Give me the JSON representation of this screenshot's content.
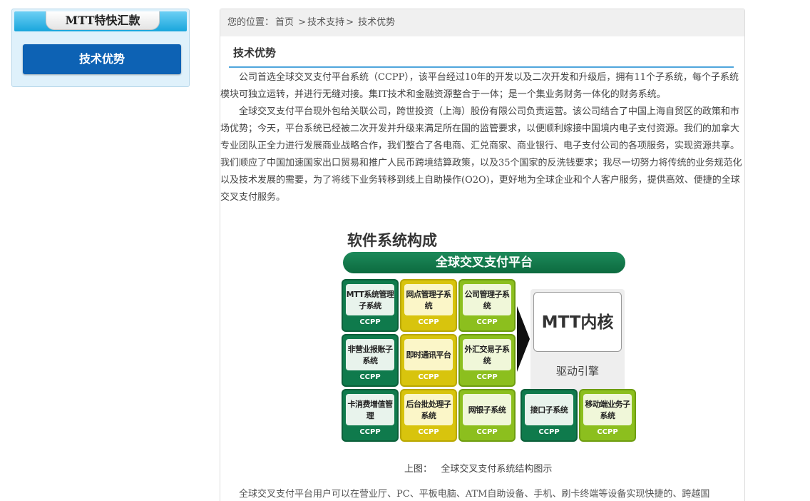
{
  "sidebar": {
    "header": "MTT特快汇款",
    "active_item": "技术优势"
  },
  "breadcrumb": {
    "prefix": "您的位置：",
    "home": "首页",
    "sep1": ">",
    "section": "技术支持",
    "sep2": ">",
    "current": "技术优势"
  },
  "article": {
    "title": "技术优势",
    "paragraphs": [
      "公司首选全球交叉支付平台系统（CCPP），该平台经过10年的开发以及二次开发和升级后，拥有11个子系统，每个子系统模块可独立运转，并进行无缝对接。集IT技术和金融资源整合于一体；是一个集业务财务一体化的财务系统。",
      "全球交叉支付平台现外包给关联公司，跨世投资（上海）股份有限公司负责运营。该公司结合了中国上海自贸区的政策和市场优势；今天，平台系统已经被二次开发并升级来满足所在国的监管要求，以便顺利嫁接中国境内电子支付资源。我们的加拿大专业团队正全力进行发展商业战略合作，我们整合了各电商、汇兑商家、商业银行、电子支付公司的各项服务，实现资源共享。我们顺应了中国加速国家出口贸易和推广人民币跨境结算政策，以及35个国家的反洗钱要求；我尽一切努力将传统的业务规范化以及技术发展的需要，为了将线下业务转移到线上自助操作(O2O)，更好地为全球企业和个人客户服务，提供高效、便捷的全球交叉支付服务。"
    ],
    "trailing_text": "全球交叉支付平台用户可以在营业厅、PC、平板电脑、ATM自助设备、手机、刷卡终端等设备实现快捷的、跨越国"
  },
  "diagram": {
    "title": "软件系统构成",
    "banner": "全球交叉支付平台",
    "tiles": [
      {
        "name": "MTT系统管理子系统",
        "sub": "CCPP",
        "color": "green"
      },
      {
        "name": "网点管理子系统",
        "sub": "CCPP",
        "color": "yellow"
      },
      {
        "name": "公司管理子系统",
        "sub": "CCPP",
        "color": "lime"
      },
      {
        "name": "非营业报账子系统",
        "sub": "CCPP",
        "color": "green"
      },
      {
        "name": "即时通讯平台",
        "sub": "CCPP",
        "color": "yellow"
      },
      {
        "name": "外汇交易子系统",
        "sub": "CCPP",
        "color": "lime"
      },
      {
        "name": "卡消费增值管理",
        "sub": "CCPP",
        "color": "green"
      },
      {
        "name": "后台批处理子系统",
        "sub": "CCPP",
        "color": "yellow"
      },
      {
        "name": "网银子系统",
        "sub": "CCPP",
        "color": "lime"
      },
      {
        "name": "接口子系统",
        "sub": "CCPP",
        "color": "green"
      },
      {
        "name": "移动端业务子系统",
        "sub": "CCPP",
        "color": "lime"
      }
    ],
    "core_title": "MTT内核",
    "core_sub": "驱动引擎",
    "caption_prefix": "上图：",
    "caption_text": "全球交叉支付系统结构图示"
  }
}
